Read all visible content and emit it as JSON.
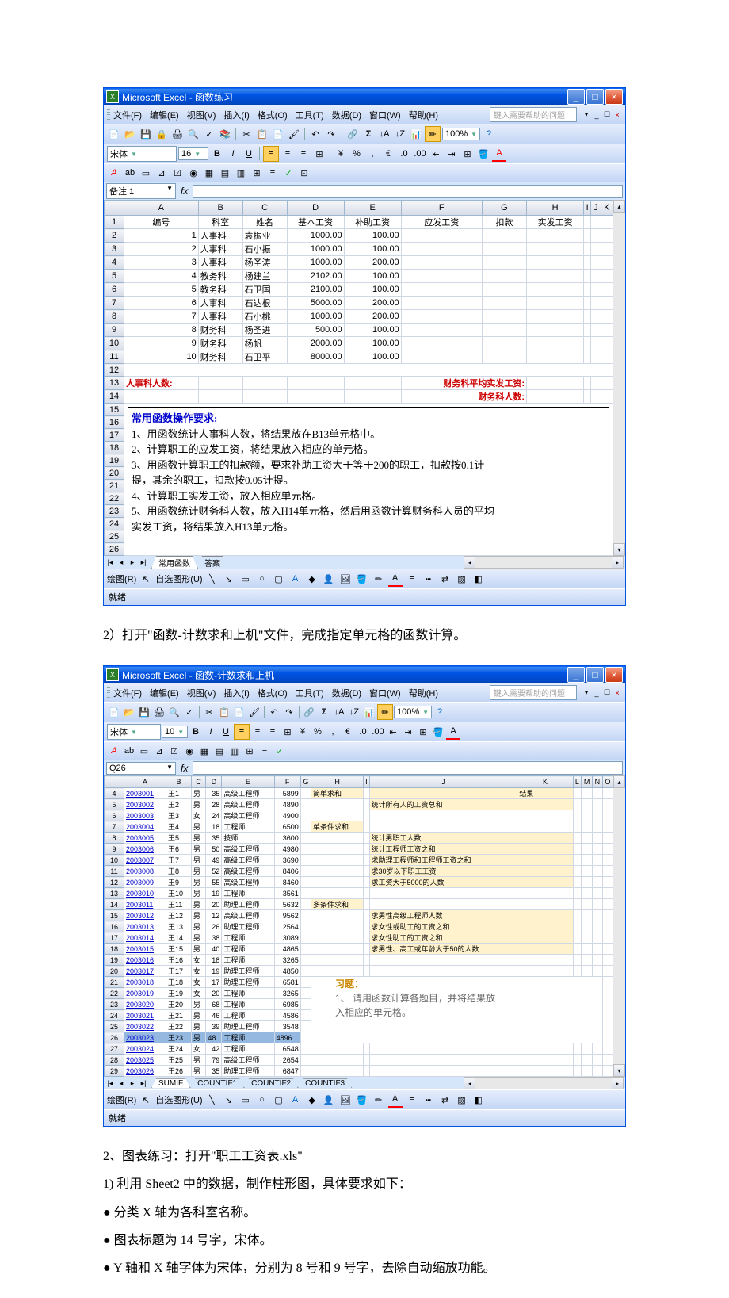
{
  "window1": {
    "app_title": "Microsoft Excel - 函数练习",
    "menus": [
      "文件(F)",
      "编辑(E)",
      "视图(V)",
      "插入(I)",
      "格式(O)",
      "工具(T)",
      "数据(D)",
      "窗口(W)",
      "帮助(H)"
    ],
    "help_placeholder": "键入需要帮助的问题",
    "font_name": "宋体",
    "font_size": "16",
    "zoom": "100%",
    "namebox": "备注 1",
    "col_headers": [
      "A",
      "B",
      "C",
      "D",
      "E",
      "F",
      "G",
      "H",
      "I",
      "J",
      "K"
    ],
    "row_labels": [
      "1",
      "2",
      "3",
      "4",
      "5",
      "6",
      "7",
      "8",
      "9",
      "10",
      "11",
      "12",
      "13",
      "14",
      "15",
      "16",
      "17",
      "18",
      "19",
      "20",
      "21",
      "22",
      "23",
      "24",
      "25",
      "26"
    ],
    "headers": [
      "编号",
      "科室",
      "姓名",
      "基本工资",
      "补助工资",
      "应发工资",
      "扣款",
      "实发工资"
    ],
    "rows": [
      [
        "1",
        "人事科",
        "袁振业",
        "1000.00",
        "100.00"
      ],
      [
        "2",
        "人事科",
        "石小振",
        "1000.00",
        "100.00"
      ],
      [
        "3",
        "人事科",
        "杨圣涛",
        "1000.00",
        "200.00"
      ],
      [
        "4",
        "教务科",
        "杨建兰",
        "2102.00",
        "100.00"
      ],
      [
        "5",
        "教务科",
        "石卫国",
        "2100.00",
        "100.00"
      ],
      [
        "6",
        "人事科",
        "石达根",
        "5000.00",
        "200.00"
      ],
      [
        "7",
        "人事科",
        "石小桃",
        "1000.00",
        "200.00"
      ],
      [
        "8",
        "财务科",
        "杨圣进",
        "500.00",
        "100.00"
      ],
      [
        "9",
        "财务科",
        "杨帆",
        "2000.00",
        "100.00"
      ],
      [
        "10",
        "财务科",
        "石卫平",
        "8000.00",
        "100.00"
      ]
    ],
    "red_label": "人事科人数:",
    "fin_avg": "财务科平均实发工资:",
    "fin_count": "财务科人数:",
    "instr_title": "常用函数操作要求:",
    "instr": [
      "1、用函数统计人事科人数，将结果放在B13单元格中。",
      "2、计算职工的应发工资，将结果放入相应的单元格。",
      "3、用函数计算职工的扣款额，要求补助工资大于等于200的职工，扣款按0.1计",
      "提，其余的职工，扣款按0.05计提。",
      "4、计算职工实发工资，放入相应单元格。",
      "5、用函数统计财务科人数，放入H14单元格，然后用函数计算财务科人员的平均",
      "实发工资，将结果放入H13单元格。"
    ],
    "sheet_tabs": [
      "常用函数",
      "答案"
    ],
    "draw_label": "绘图(R)",
    "autoshape": "自选图形(U)",
    "status": "就绪"
  },
  "between_text": "2）打开\"函数-计数求和上机\"文件，完成指定单元格的函数计算。",
  "window2": {
    "app_title": "Microsoft Excel - 函数-计数求和上机",
    "menus": [
      "文件(F)",
      "编辑(E)",
      "视图(V)",
      "插入(I)",
      "格式(O)",
      "工具(T)",
      "数据(D)",
      "窗口(W)",
      "帮助(H)"
    ],
    "help_placeholder": "键入需要帮助的问题",
    "font_name": "宋体",
    "font_size": "10",
    "zoom": "100%",
    "namebox": "Q26",
    "col_headers": [
      "A",
      "B",
      "C",
      "D",
      "E",
      "F",
      "G",
      "H",
      "I",
      "J",
      "K",
      "L",
      "M",
      "N",
      "O"
    ],
    "row_labels": [
      "4",
      "5",
      "6",
      "7",
      "8",
      "9",
      "10",
      "11",
      "12",
      "13",
      "14",
      "15",
      "16",
      "17",
      "18",
      "19",
      "20",
      "21",
      "22",
      "23",
      "24",
      "25",
      "26",
      "27",
      "28",
      "29"
    ],
    "rows": [
      [
        "2003001",
        "王1",
        "男",
        "35",
        "高级工程师",
        "5899"
      ],
      [
        "2003002",
        "王2",
        "男",
        "28",
        "高级工程师",
        "4890"
      ],
      [
        "2003003",
        "王3",
        "女",
        "24",
        "高级工程师",
        "4900"
      ],
      [
        "2003004",
        "王4",
        "男",
        "18",
        "工程师",
        "6500"
      ],
      [
        "2003005",
        "王5",
        "男",
        "35",
        "技师",
        "3600"
      ],
      [
        "2003006",
        "王6",
        "男",
        "50",
        "高级工程师",
        "4980"
      ],
      [
        "2003007",
        "王7",
        "男",
        "49",
        "高级工程师",
        "3690"
      ],
      [
        "2003008",
        "王8",
        "男",
        "52",
        "高级工程师",
        "8406"
      ],
      [
        "2003009",
        "王9",
        "男",
        "55",
        "高级工程师",
        "8460"
      ],
      [
        "2003010",
        "王10",
        "男",
        "19",
        "工程师",
        "3561"
      ],
      [
        "2003011",
        "王11",
        "男",
        "20",
        "助理工程师",
        "5632"
      ],
      [
        "2003012",
        "王12",
        "男",
        "12",
        "高级工程师",
        "9562"
      ],
      [
        "2003013",
        "王13",
        "男",
        "26",
        "助理工程师",
        "2564"
      ],
      [
        "2003014",
        "王14",
        "男",
        "38",
        "工程师",
        "3089"
      ],
      [
        "2003015",
        "王15",
        "男",
        "40",
        "工程师",
        "4865"
      ],
      [
        "2003016",
        "王16",
        "女",
        "18",
        "工程师",
        "3265"
      ],
      [
        "2003017",
        "王17",
        "女",
        "19",
        "助理工程师",
        "4850"
      ],
      [
        "2003018",
        "王18",
        "女",
        "17",
        "助理工程师",
        "6581"
      ],
      [
        "2003019",
        "王19",
        "女",
        "20",
        "工程师",
        "3265"
      ],
      [
        "2003020",
        "王20",
        "男",
        "68",
        "工程师",
        "6985"
      ],
      [
        "2003021",
        "王21",
        "男",
        "46",
        "工程师",
        "4586"
      ],
      [
        "2003022",
        "王22",
        "男",
        "39",
        "助理工程师",
        "3548"
      ],
      [
        "2003023",
        "王23",
        "男",
        "48",
        "工程师",
        "4896"
      ],
      [
        "2003024",
        "王24",
        "女",
        "42",
        "工程师",
        "6548"
      ],
      [
        "2003025",
        "王25",
        "男",
        "79",
        "高级工程师",
        "2654"
      ],
      [
        "2003026",
        "王26",
        "男",
        "35",
        "助理工程师",
        "6847"
      ]
    ],
    "side_labels": {
      "simple_sum_h": "简单求和",
      "result_h": "结果",
      "l1": "统计所有人的工资总和",
      "single_h": "单条件求和",
      "l2": "统计男职工人数",
      "l3": "统计工程师工资之和",
      "l4": "求助理工程师和工程师工资之和",
      "l5": "求30岁以下职工工资",
      "l6": "求工资大于5000的人数",
      "multi_h": "多条件求和",
      "l7": "求男性高级工程师人数",
      "l8": "求女性或助工的工资之和",
      "l9": "求女性助工的工资之和",
      "l10": "求男性、高工或年龄大于50的人数",
      "ex_title": "习题：",
      "ex1": "1、 请用函数计算各题目，并将结果放",
      "ex2": "入相应的单元格。"
    },
    "sheet_tabs": [
      "SUMIF",
      "COUNTIF1",
      "COUNTIF2",
      "COUNTIF3"
    ],
    "status": "就绪"
  },
  "body_lines": [
    "2、图表练习：打开\"职工工资表.xls\"",
    "1) 利用 Sheet2 中的数据，制作柱形图，具体要求如下：",
    "● 分类 X 轴为各科室名称。",
    "● 图表标题为 14 号字，宋体。",
    "● Y 轴和 X 轴字体为宋体，分别为 8 号和 9 号字，去除自动缩放功能。"
  ]
}
